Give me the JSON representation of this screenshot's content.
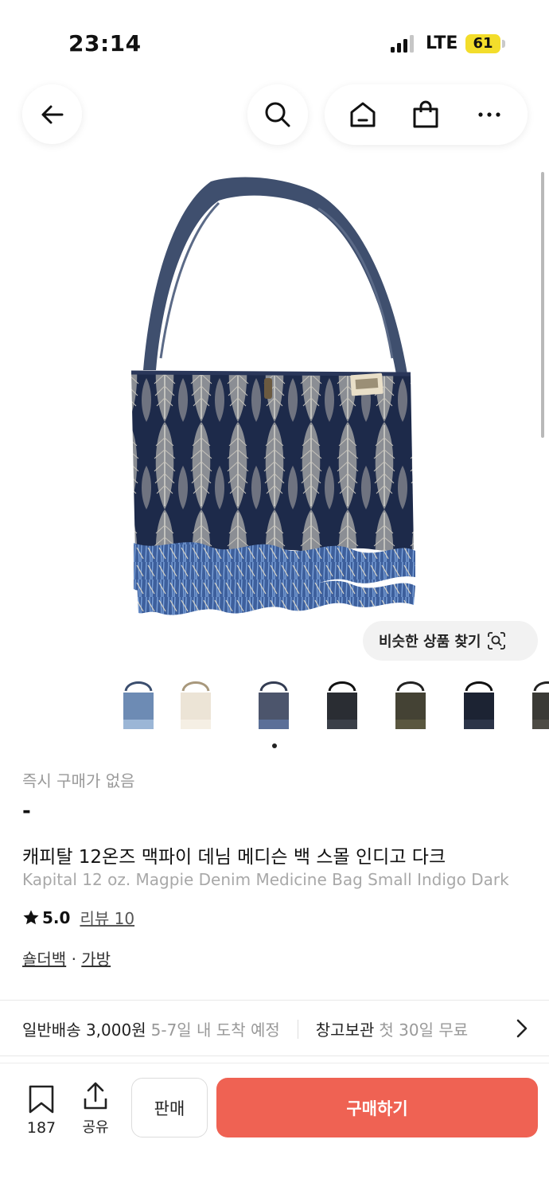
{
  "status_bar": {
    "time": "23:14",
    "network": "LTE",
    "battery": "61"
  },
  "nav": {
    "back_icon": "back-arrow-icon",
    "search_icon": "search-icon",
    "home_icon": "home-icon",
    "bag_icon": "shopping-bag-icon",
    "more_icon": "more-icon"
  },
  "product": {
    "similar_button": "비슷한 상품 찾기",
    "thumbnail_count": 8,
    "active_thumbnail": 3,
    "instant_purchase_status": "즉시 구매가 없음",
    "price": "-",
    "title_ko": "캐피탈 12온즈 맥파이 데님 메디슨 백 스몰 인디고 다크",
    "title_en": "Kapital 12 oz. Magpie Denim Medicine Bag Small Indigo Dark",
    "rating": "5.0",
    "reviews_label": "리뷰 10",
    "category": [
      "숄더백",
      "가방"
    ],
    "category_separator": "·"
  },
  "delivery": {
    "standard_label": "일반배송 3,000원",
    "standard_eta": "5-7일 내 도착 예정",
    "warehouse_label": "창고보관",
    "warehouse_promo": "첫 30일 무료"
  },
  "bottom_bar": {
    "bookmark_count": "187",
    "share_label": "공유",
    "sell_label": "판매",
    "buy_label": "구매하기"
  },
  "colors": {
    "buy_button": "#ef6253",
    "battery": "#f3dd2b"
  }
}
